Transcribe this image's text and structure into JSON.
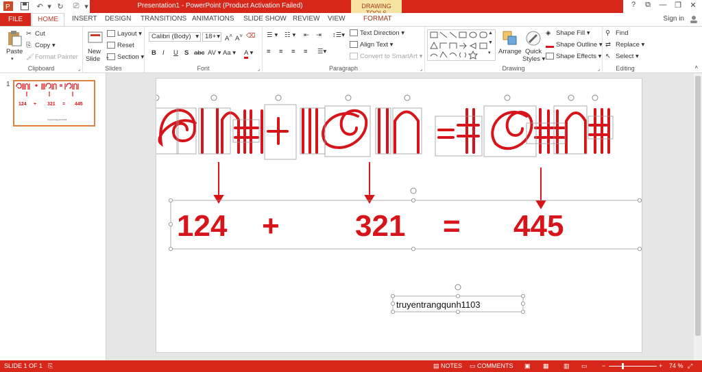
{
  "window": {
    "title": "Presentation1 - PowerPoint (Product Activation Failed)",
    "context_tab": "DRAWING TOOLS",
    "controls": [
      "?",
      "⧉",
      "—",
      "❐",
      "✕"
    ]
  },
  "tabs": {
    "file": "FILE",
    "home": "HOME",
    "items": [
      "INSERT",
      "DESIGN",
      "TRANSITIONS",
      "ANIMATIONS",
      "SLIDE SHOW",
      "REVIEW",
      "VIEW"
    ],
    "format": "FORMAT",
    "signin": "Sign in"
  },
  "ribbon": {
    "clipboard": {
      "label": "Clipboard",
      "paste": "Paste",
      "cut": "Cut",
      "copy": "Copy",
      "format_painter": "Format Painter"
    },
    "slides": {
      "label": "Slides",
      "new_slide": "New",
      "new_slide2": "Slide",
      "layout": "Layout",
      "reset": "Reset",
      "section": "Section"
    },
    "font": {
      "label": "Font",
      "family": "Calibri (Body)",
      "size": "18+",
      "buttons": [
        "B",
        "I",
        "U",
        "S",
        "abc",
        "AV",
        "Aa",
        "A"
      ]
    },
    "paragraph": {
      "label": "Paragraph",
      "text_direction": "Text Direction",
      "align_text": "Align Text",
      "convert": "Convert to SmartArt"
    },
    "drawing": {
      "label": "Drawing",
      "arrange": "Arrange",
      "quick_styles": "Quick",
      "quick_styles2": "Styles",
      "shape_fill": "Shape Fill",
      "shape_outline": "Shape Outline",
      "shape_effects": "Shape Effects"
    },
    "editing": {
      "label": "Editing",
      "find": "Find",
      "replace": "Replace",
      "select": "Select"
    }
  },
  "thumbnail": {
    "number": "1"
  },
  "slide": {
    "equation": {
      "a": "124",
      "plus": "+",
      "b": "321",
      "equals": "=",
      "c": "445"
    },
    "caption": "truyentrangqunh1103",
    "accent_color": "#d7141a"
  },
  "status": {
    "slide": "SLIDE 1 OF 1",
    "notes": "NOTES",
    "comments": "COMMENTS",
    "zoom": "74 %"
  }
}
